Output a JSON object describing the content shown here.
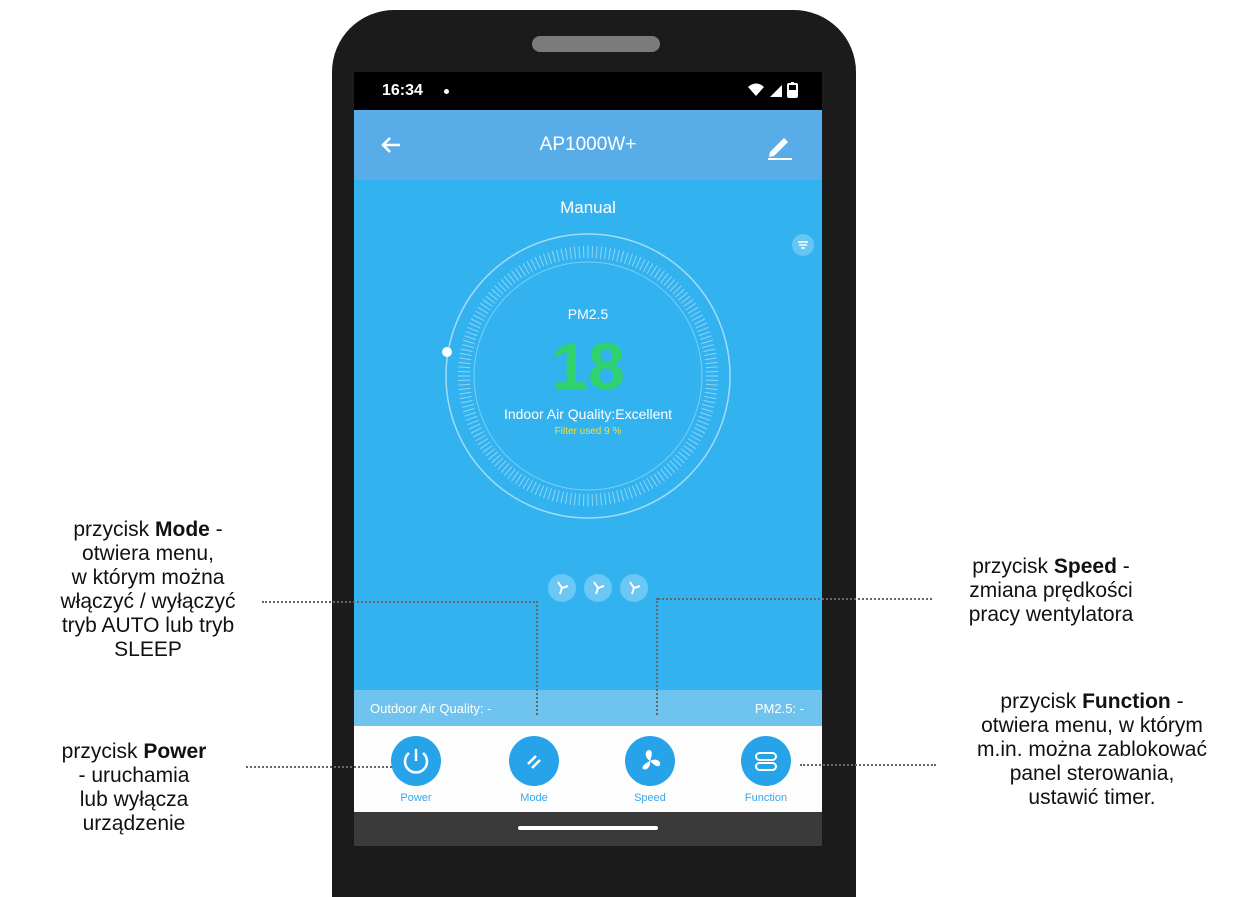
{
  "status": {
    "time": "16:34"
  },
  "appbar": {
    "title": "AP1000W+"
  },
  "main": {
    "mode": "Manual",
    "pm_label": "PM2.5",
    "pm_value": "18",
    "indoor_quality": "Indoor Air Quality:Excellent",
    "filter": "Filter used 9 %",
    "pm_ring_fraction": 0.5
  },
  "outdoor": {
    "left": "Outdoor Air Quality: -",
    "right": "PM2.5: -"
  },
  "buttons": [
    {
      "label": "Power",
      "icon": "power-icon"
    },
    {
      "label": "Mode",
      "icon": "mode-icon"
    },
    {
      "label": "Speed",
      "icon": "fan-icon"
    },
    {
      "label": "Function",
      "icon": "function-icon"
    }
  ],
  "callouts": {
    "mode": {
      "pre": "przycisk ",
      "bold": "Mode",
      "post": " -",
      "rest": [
        "otwiera menu,",
        "w którym można",
        "włączyć / wyłączyć",
        "tryb AUTO lub tryb",
        "SLEEP"
      ]
    },
    "power": {
      "pre": "przycisk ",
      "bold": "Power",
      "post": "",
      "rest": [
        "- uruchamia",
        "lub wyłącza",
        "urządzenie"
      ]
    },
    "speed": {
      "pre": "przycisk ",
      "bold": "Speed",
      "post": " -",
      "rest": [
        "zmiana prędkości",
        "pracy wentylatora"
      ]
    },
    "function": {
      "pre": "przycisk ",
      "bold": "Function",
      "post": " -",
      "rest": [
        "otwiera menu, w którym",
        "m.in. można zablokować",
        "panel sterowania,",
        "ustawić timer."
      ]
    }
  },
  "colors": {
    "accent": "#27a3ea",
    "pm_green": "#2fd36d",
    "filter_yellow": "#e8e04a"
  }
}
